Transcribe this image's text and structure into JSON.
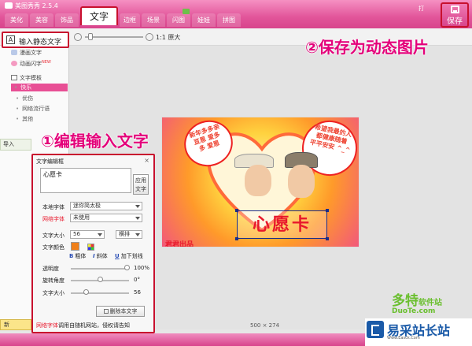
{
  "app": {
    "title": "美图秀秀 2.5.4"
  },
  "tabs": [
    {
      "label": "美化",
      "active": false
    },
    {
      "label": "美容",
      "active": false
    },
    {
      "label": "饰品",
      "active": false
    },
    {
      "label": "文字",
      "active": true
    },
    {
      "label": "边框",
      "active": false
    },
    {
      "label": "场景",
      "active": false
    },
    {
      "label": "闪图",
      "active": false,
      "badge": ""
    },
    {
      "label": "娃娃",
      "active": false
    },
    {
      "label": "拼图",
      "active": false
    }
  ],
  "header": {
    "save_label": "保存",
    "open_label": "打"
  },
  "toolbar": {
    "zoom_label": "1:1 原大"
  },
  "left_panel": {
    "input_static_text": "输入静态文字",
    "items": [
      {
        "label": "漫画文字"
      },
      {
        "label": "动画闪字",
        "hot": "NEW"
      }
    ],
    "template_header": "文字模板",
    "template_items": [
      {
        "label": "快乐",
        "active": true
      },
      {
        "label": "优伤",
        "active": false
      },
      {
        "label": "网络流行语",
        "active": false
      },
      {
        "label": "其他",
        "active": false
      }
    ],
    "import_label": "导入",
    "new_label": "新"
  },
  "canvas": {
    "dimensions": "500 × 274",
    "card_text": "心愿卡",
    "signature": "君君出品",
    "bubble_left": [
      "新年多多亲",
      "亘恩 爱多",
      "多 爱恩"
    ],
    "bubble_right": [
      "希望我最的人",
      "都健康随着",
      "平平安安 ^_^"
    ]
  },
  "annotations": {
    "step1": "①编辑输入文字",
    "step2": "②保存为动态图片"
  },
  "editor": {
    "title": "文字编辑框",
    "close": "×",
    "text_value": "心愿卡",
    "apply_label": "应用文字",
    "local_font_label": "本地字体",
    "local_font_value": "迷你简太极",
    "web_font_label": "网络字体",
    "web_font_value": "未使用",
    "size_label": "文字大小",
    "size_value": "56",
    "orientation_value": "横排",
    "color_label": "文字颜色",
    "bold_label": "粗体",
    "italic_label": "斜体",
    "underline_label": "加下划线",
    "opacity_label": "透明度",
    "opacity_value": "100%",
    "rotation_label": "旋转角度",
    "rotation_value": "0°",
    "font_size_label": "文字大小",
    "font_size_value": "56",
    "delete_label": "删除本文字",
    "footer_red": "网络字体",
    "footer_text": "调用自随机网站，侵权请告知"
  },
  "watermarks": {
    "duote_big": "多特",
    "duote_small": "软件站",
    "duote_url": "DuoTe.com",
    "yicai_name": "易采站长站",
    "yicai_url": "Www.Easck.Com"
  },
  "colors": {
    "brand_pink": "#e2559a",
    "highlight_red": "#c8102e",
    "annotation_magenta": "#e4007a",
    "text_color_swatch": "#f0801a"
  }
}
